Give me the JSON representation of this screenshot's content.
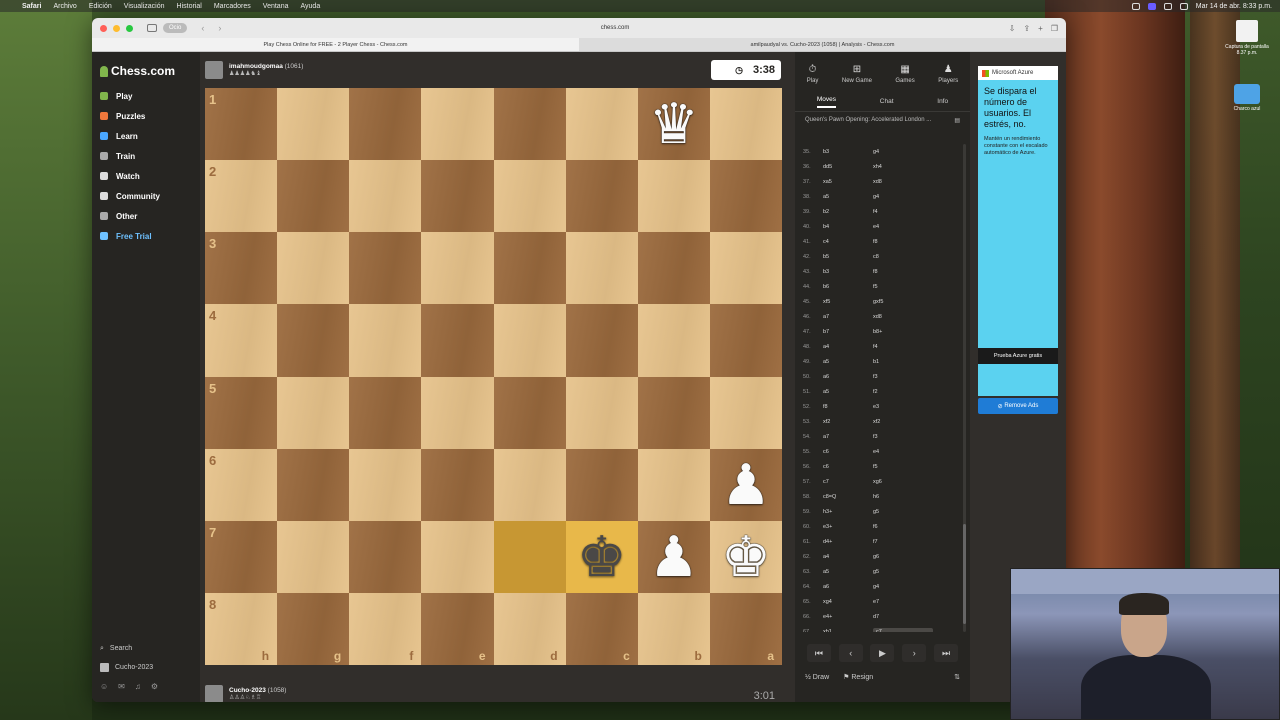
{
  "menubar": {
    "app": "Safari",
    "items": [
      "Archivo",
      "Edición",
      "Visualización",
      "Historial",
      "Marcadores",
      "Ventana",
      "Ayuda"
    ],
    "clock": "Mar 14 de abr. 8:33 p.m."
  },
  "browser": {
    "profile": "Ocio",
    "url": "chess.com",
    "tabs": [
      "Play Chess Online for FREE - 2 Player Chess - Chess.com",
      "amilpaudyal vs. Cucho-2023 (1058) | Analysis - Chess.com"
    ]
  },
  "nav": {
    "logo": "Chess.com",
    "items": [
      {
        "label": "Play",
        "color": "#81b64c"
      },
      {
        "label": "Puzzles",
        "color": "#f0783c"
      },
      {
        "label": "Learn",
        "color": "#4aa7ff"
      },
      {
        "label": "Train",
        "color": "#aaaaaa"
      },
      {
        "label": "Watch",
        "color": "#dddddd"
      },
      {
        "label": "Community",
        "color": "#dddddd"
      },
      {
        "label": "Other",
        "color": "#aaaaaa"
      },
      {
        "label": "Free Trial",
        "color": "#6ec1ff"
      }
    ],
    "search": "Search",
    "user": "Cucho-2023"
  },
  "top_player": {
    "name": "imahmoudgomaa",
    "rating": "(1061)",
    "clock": "3:38"
  },
  "bottom_player": {
    "name": "Cucho-2023",
    "rating": "(1058)",
    "clock": "3:01"
  },
  "board": {
    "ranks": [
      "1",
      "2",
      "3",
      "4",
      "5",
      "6",
      "7",
      "8"
    ],
    "files": [
      "h",
      "g",
      "f",
      "e",
      "d",
      "c",
      "b",
      "a"
    ],
    "highlight": [
      [
        6,
        4
      ],
      [
        6,
        5
      ]
    ],
    "pieces": [
      {
        "row": 0,
        "col": 6,
        "glyph": "♛",
        "side": "w",
        "name": "white-queen"
      },
      {
        "row": 5,
        "col": 7,
        "glyph": "♟",
        "side": "w",
        "name": "white-pawn"
      },
      {
        "row": 6,
        "col": 5,
        "glyph": "♚",
        "side": "b",
        "name": "black-king"
      },
      {
        "row": 6,
        "col": 6,
        "glyph": "♟",
        "side": "w",
        "name": "white-pawn"
      },
      {
        "row": 6,
        "col": 7,
        "glyph": "♚",
        "side": "w",
        "name": "white-king"
      }
    ]
  },
  "panel": {
    "top_buttons": [
      "Play",
      "New Game",
      "Games",
      "Players"
    ],
    "tabs": [
      "Moves",
      "Chat",
      "Info"
    ],
    "opening": "Queen's Pawn Opening: Accelerated London ...",
    "moves": [
      [
        "35.",
        "b3",
        "g4"
      ],
      [
        "36.",
        "dd5",
        "xh4"
      ],
      [
        "37.",
        "xa5",
        "xd8"
      ],
      [
        "38.",
        "a5",
        "g4"
      ],
      [
        "39.",
        "b2",
        "f4"
      ],
      [
        "40.",
        "b4",
        "e4"
      ],
      [
        "41.",
        "c4",
        "f8"
      ],
      [
        "42.",
        "b5",
        "c8"
      ],
      [
        "43.",
        "b3",
        "f8"
      ],
      [
        "44.",
        "b6",
        "f5"
      ],
      [
        "45.",
        "xf5",
        "gxf5"
      ],
      [
        "46.",
        "a7",
        "xd8"
      ],
      [
        "47.",
        "b7",
        "b8+"
      ],
      [
        "48.",
        "a4",
        "f4"
      ],
      [
        "49.",
        "a5",
        "b1"
      ],
      [
        "50.",
        "a6",
        "f3"
      ],
      [
        "51.",
        "a5",
        "f2"
      ],
      [
        "52.",
        "f8",
        "e3"
      ],
      [
        "53.",
        "xf2",
        "xf2"
      ],
      [
        "54.",
        "a7",
        "f3"
      ],
      [
        "55.",
        "c6",
        "e4"
      ],
      [
        "56.",
        "c6",
        "f5"
      ],
      [
        "57.",
        "c7",
        "xg6"
      ],
      [
        "58.",
        "c8=Q",
        "h6"
      ],
      [
        "59.",
        "h3+",
        "g5"
      ],
      [
        "60.",
        "e3+",
        "f6"
      ],
      [
        "61.",
        "d4+",
        "f7"
      ],
      [
        "62.",
        "a4",
        "g6"
      ],
      [
        "63.",
        "a5",
        "g5"
      ],
      [
        "64.",
        "a6",
        "g4"
      ],
      [
        "65.",
        "xg4",
        "e7"
      ],
      [
        "66.",
        "e4+",
        "d7"
      ],
      [
        "67.",
        "xb1",
        "c7"
      ]
    ],
    "actions": {
      "draw": "Draw",
      "resign": "Resign"
    }
  },
  "ad": {
    "brand": "Microsoft Azure",
    "title": "Se dispara el número de usuarios. El estrés, no.",
    "sub": "Mantén un rendimiento constante con el escalado automático de Azure.",
    "cta": "Prueba Azure gratis",
    "remove": "Remove Ads"
  },
  "desktop": {
    "icon1": "Captura de pantalla 8.37 p.m.",
    "icon2": "Charco azul"
  }
}
